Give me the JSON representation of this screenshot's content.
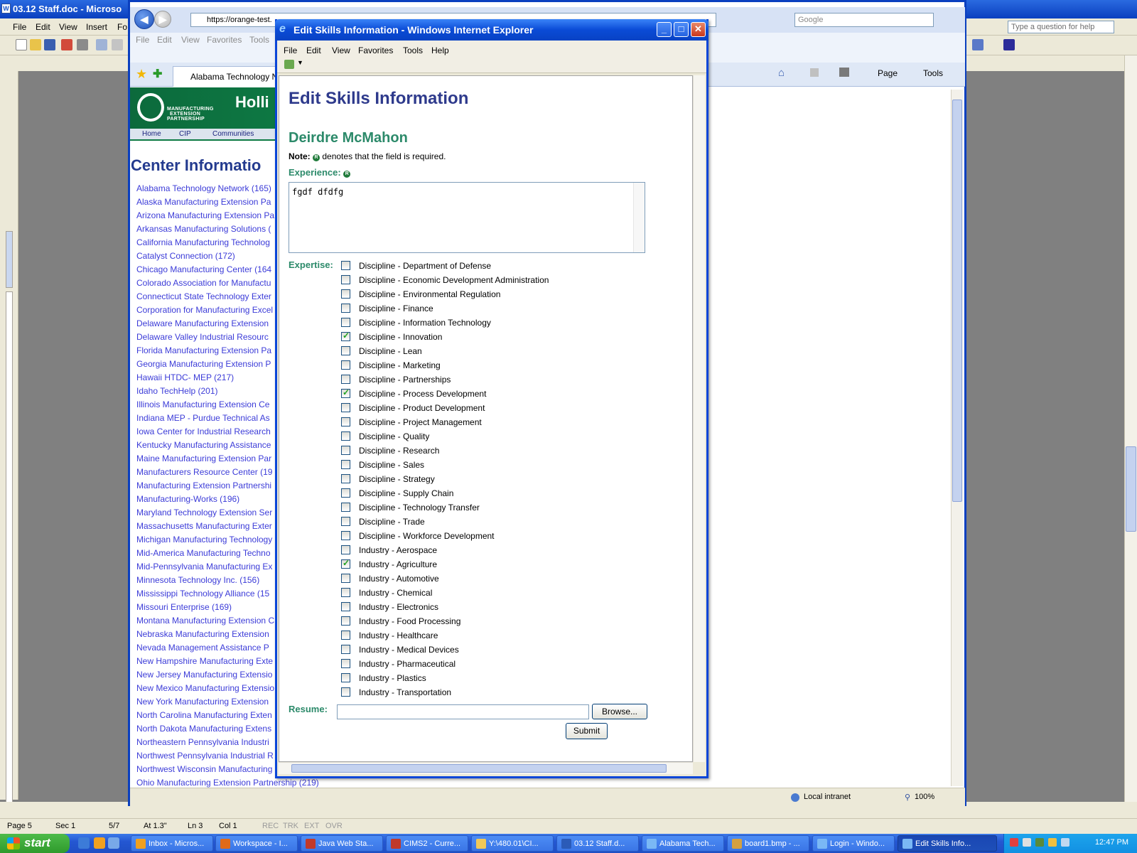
{
  "word": {
    "title": "03.12 Staff.doc - Microso",
    "menu": [
      "File",
      "Edit",
      "View",
      "Insert",
      "Fo"
    ],
    "help_placeholder": "Type a question for help",
    "status": {
      "page": "Page 5",
      "sec": "Sec 1",
      "pages": "5/7",
      "at": "At 1.3\"",
      "ln": "Ln 3",
      "col": "Col 1",
      "rec": "REC",
      "trk": "TRK",
      "ext": "EXT",
      "ovr": "OVR"
    }
  },
  "ie_back": {
    "url": "https://orange-test.",
    "search_placeholder": "Google",
    "menu": [
      "File",
      "Edit",
      "View",
      "Favorites",
      "Tools"
    ],
    "tab_label": "Alabama Technology Ne",
    "commands": {
      "page": "Page",
      "tools": "Tools"
    },
    "site": {
      "brand": "Holli",
      "logo_text": [
        "MANUFACTURING",
        "EXTENSION",
        "PARTNERSHIP"
      ],
      "nav": [
        "Home",
        "CIP",
        "Communities"
      ]
    },
    "heading": "Center Informatio",
    "centers": [
      "Alabama Technology Network (165)",
      "Alaska Manufacturing Extension Pa",
      "Arizona Manufacturing Extension Pa",
      "Arkansas Manufacturing Solutions (",
      "California Manufacturing Technolog",
      "Catalyst Connection (172)",
      "Chicago Manufacturing Center (164",
      "Colorado Association for Manufactu",
      "Connecticut State Technology Exter",
      "Corporation for Manufacturing Excel",
      "Delaware Manufacturing Extension",
      "Delaware Valley Industrial Resourc",
      "Florida Manufacturing Extension Pa",
      "Georgia Manufacturing Extension P",
      "Hawaii HTDC- MEP (217)",
      "Idaho TechHelp (201)",
      "Illinois Manufacturing Extension Ce",
      "Indiana MEP - Purdue Technical As",
      "Iowa Center for Industrial Research",
      "Kentucky Manufacturing Assistance",
      "Maine Manufacturing Extension Par",
      "Manufacturers Resource Center (19",
      "Manufacturing Extension Partnershi",
      "Manufacturing-Works (196)",
      "Maryland Technology Extension Ser",
      "Massachusetts Manufacturing Exter",
      "Michigan Manufacturing Technology",
      "Mid-America Manufacturing Techno",
      "Mid-Pennsylvania Manufacturing Ex",
      "Minnesota Technology Inc. (156)",
      "Mississippi Technology Alliance (15",
      "Missouri Enterprise (169)",
      "Montana Manufacturing Extension C",
      "Nebraska Manufacturing Extension",
      "Nevada Management Assistance P",
      "New Hampshire Manufacturing Exte",
      "New Jersey Manufacturing Extensio",
      "New Mexico Manufacturing Extensio",
      "New York Manufacturing Extension",
      "North Carolina Manufacturing Exten",
      "North Dakota Manufacturing Extens",
      "Northeastern Pennsylvania Industri",
      "Northwest Pennsylvania Industrial R",
      "Northwest Wisconsin Manufacturing",
      "Ohio Manufacturing Extension Partnership (219)"
    ],
    "zone": "Local intranet",
    "zoom": "100%"
  },
  "popup": {
    "window_title": "Edit Skills Information - Windows Internet Explorer",
    "menu": [
      "File",
      "Edit",
      "View",
      "Favorites",
      "Tools",
      "Help"
    ],
    "heading": "Edit Skills Information",
    "person": "Deirdre McMahon",
    "note_prefix": "Note:",
    "note_suffix": "denotes that the field is required.",
    "experience_label": "Experience:",
    "experience_value": "fgdf dfdfg",
    "expertise_label": "Expertise:",
    "skills": [
      {
        "label": "Discipline - Department of Defense",
        "checked": false
      },
      {
        "label": "Discipline - Economic Development Administration",
        "checked": false
      },
      {
        "label": "Discipline - Environmental Regulation",
        "checked": false
      },
      {
        "label": "Discipline - Finance",
        "checked": false
      },
      {
        "label": "Discipline - Information Technology",
        "checked": false
      },
      {
        "label": "Discipline - Innovation",
        "checked": true
      },
      {
        "label": "Discipline - Lean",
        "checked": false
      },
      {
        "label": "Discipline - Marketing",
        "checked": false
      },
      {
        "label": "Discipline - Partnerships",
        "checked": false
      },
      {
        "label": "Discipline - Process Development",
        "checked": true
      },
      {
        "label": "Discipline - Product Development",
        "checked": false
      },
      {
        "label": "Discipline - Project Management",
        "checked": false
      },
      {
        "label": "Discipline - Quality",
        "checked": false
      },
      {
        "label": "Discipline - Research",
        "checked": false
      },
      {
        "label": "Discipline - Sales",
        "checked": false
      },
      {
        "label": "Discipline - Strategy",
        "checked": false
      },
      {
        "label": "Discipline - Supply Chain",
        "checked": false
      },
      {
        "label": "Discipline - Technology Transfer",
        "checked": false
      },
      {
        "label": "Discipline - Trade",
        "checked": false
      },
      {
        "label": "Discipline - Workforce Development",
        "checked": false
      },
      {
        "label": "Industry - Aerospace",
        "checked": false
      },
      {
        "label": "Industry - Agriculture",
        "checked": true
      },
      {
        "label": "Industry - Automotive",
        "checked": false
      },
      {
        "label": "Industry - Chemical",
        "checked": false
      },
      {
        "label": "Industry - Electronics",
        "checked": false
      },
      {
        "label": "Industry - Food Processing",
        "checked": false
      },
      {
        "label": "Industry - Healthcare",
        "checked": false
      },
      {
        "label": "Industry - Medical Devices",
        "checked": false
      },
      {
        "label": "Industry - Pharmaceutical",
        "checked": false
      },
      {
        "label": "Industry - Plastics",
        "checked": false
      },
      {
        "label": "Industry - Transportation",
        "checked": false
      }
    ],
    "resume_label": "Resume:",
    "browse_label": "Browse...",
    "submit_label": "Submit"
  },
  "taskbar": {
    "start": "start",
    "tasks": [
      {
        "label": "Inbox - Micros...",
        "icon": "outlook-icon",
        "active": false
      },
      {
        "label": "Workspace - I...",
        "icon": "firefox-icon",
        "active": false
      },
      {
        "label": "Java Web Sta...",
        "icon": "java-icon",
        "active": false
      },
      {
        "label": "CIMS2 - Curre...",
        "icon": "java-icon",
        "active": false
      },
      {
        "label": "Y:\\480.01\\CI...",
        "icon": "folder-icon",
        "active": false
      },
      {
        "label": "03.12 Staff.d...",
        "icon": "word-icon",
        "active": false
      },
      {
        "label": "Alabama Tech...",
        "icon": "ie-icon",
        "active": false
      },
      {
        "label": "board1.bmp - ...",
        "icon": "paint-icon",
        "active": false
      },
      {
        "label": "Login - Windo...",
        "icon": "ie-icon",
        "active": false
      },
      {
        "label": "Edit Skills Info...",
        "icon": "ie-icon",
        "active": true
      }
    ],
    "clock": "12:47 PM"
  }
}
